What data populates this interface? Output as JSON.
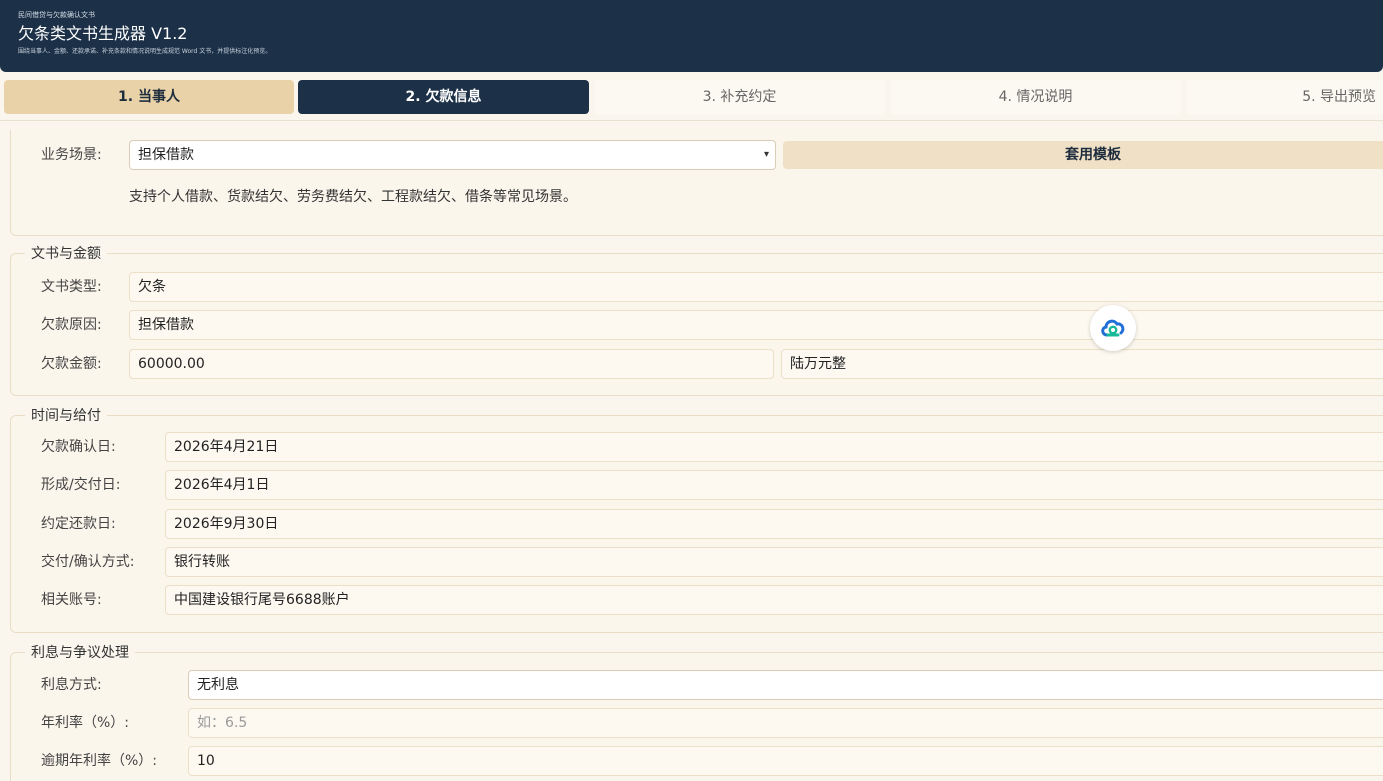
{
  "header": {
    "subtitle": "民间借贷与欠款确认文书",
    "title": "欠条类文书生成器 V1.2",
    "description": "围绕当事人、金额、还款承诺、补充条款和情况说明生成规范 Word 文书，并提供标注化预览。"
  },
  "tabs": [
    {
      "label": "1. 当事人",
      "state": "done"
    },
    {
      "label": "2. 欠款信息",
      "state": "active"
    },
    {
      "label": "3. 补充约定",
      "state": "todo"
    },
    {
      "label": "4. 情况说明",
      "state": "todo"
    },
    {
      "label": "5. 导出预览",
      "state": "todo"
    }
  ],
  "scene": {
    "label": "业务场景:",
    "value": "担保借款",
    "apply_button": "套用模板",
    "hint": "支持个人借款、货款结欠、劳务费结欠、工程款结欠、借条等常见场景。"
  },
  "doc_amount": {
    "title": "文书与金额",
    "doc_type_label": "文书类型:",
    "doc_type_value": "欠条",
    "reason_label": "欠款原因:",
    "reason_value": "担保借款",
    "amount_label": "欠款金额:",
    "amount_value": "60000.00",
    "amount_upper": "陆万元整"
  },
  "time_payment": {
    "title": "时间与给付",
    "confirm_date_label": "欠款确认日:",
    "confirm_date_value": "2026年4月21日",
    "form_date_label": "形成/交付日:",
    "form_date_value": "2026年4月1日",
    "due_date_label": "约定还款日:",
    "due_date_value": "2026年9月30日",
    "method_label": "交付/确认方式:",
    "method_value": "银行转账",
    "account_label": "相关账号:",
    "account_value": "中国建设银行尾号6688账户"
  },
  "interest": {
    "title": "利息与争议处理",
    "mode_label": "利息方式:",
    "mode_value": "无利息",
    "rate_label": "年利率（%）:",
    "rate_placeholder": "如：6.5",
    "overdue_label": "逾期年利率（%）:",
    "overdue_value": "10"
  },
  "colors": {
    "header_bg": "#1c3148",
    "tab_done": "#e9d2a8",
    "tab_active": "#1c3148",
    "page_bg": "#faf6ee"
  },
  "icons": {
    "floating": "cloud-icon"
  }
}
